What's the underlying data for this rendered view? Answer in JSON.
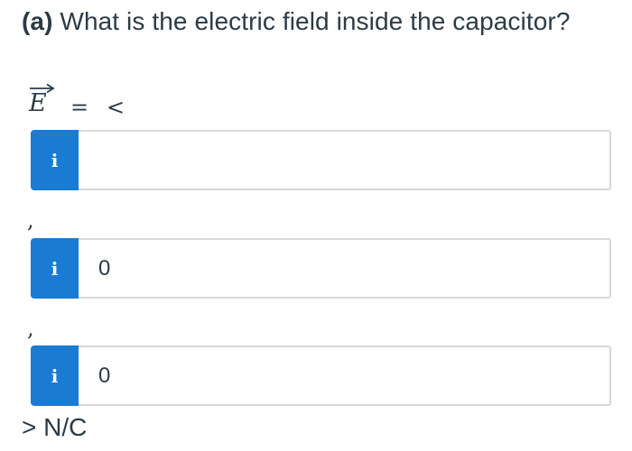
{
  "question": {
    "part_label": "(a)",
    "text": "What is the electric field inside the capacitor?"
  },
  "equation": {
    "vector_symbol": "E",
    "equals": "=",
    "open_bracket": "<"
  },
  "answers": [
    {
      "value": "",
      "info_icon": "i"
    },
    {
      "value": "0",
      "info_icon": "i"
    },
    {
      "value": "0",
      "info_icon": "i"
    }
  ],
  "separators": [
    ",",
    ","
  ],
  "closing": {
    "bracket": ">",
    "units": "N/C"
  },
  "colors": {
    "info_button": "#1a7bd3",
    "text": "#2d3b45",
    "input_border": "#d8d8d8"
  },
  "icons": [
    "info-icon",
    "vector-arrow-icon"
  ]
}
